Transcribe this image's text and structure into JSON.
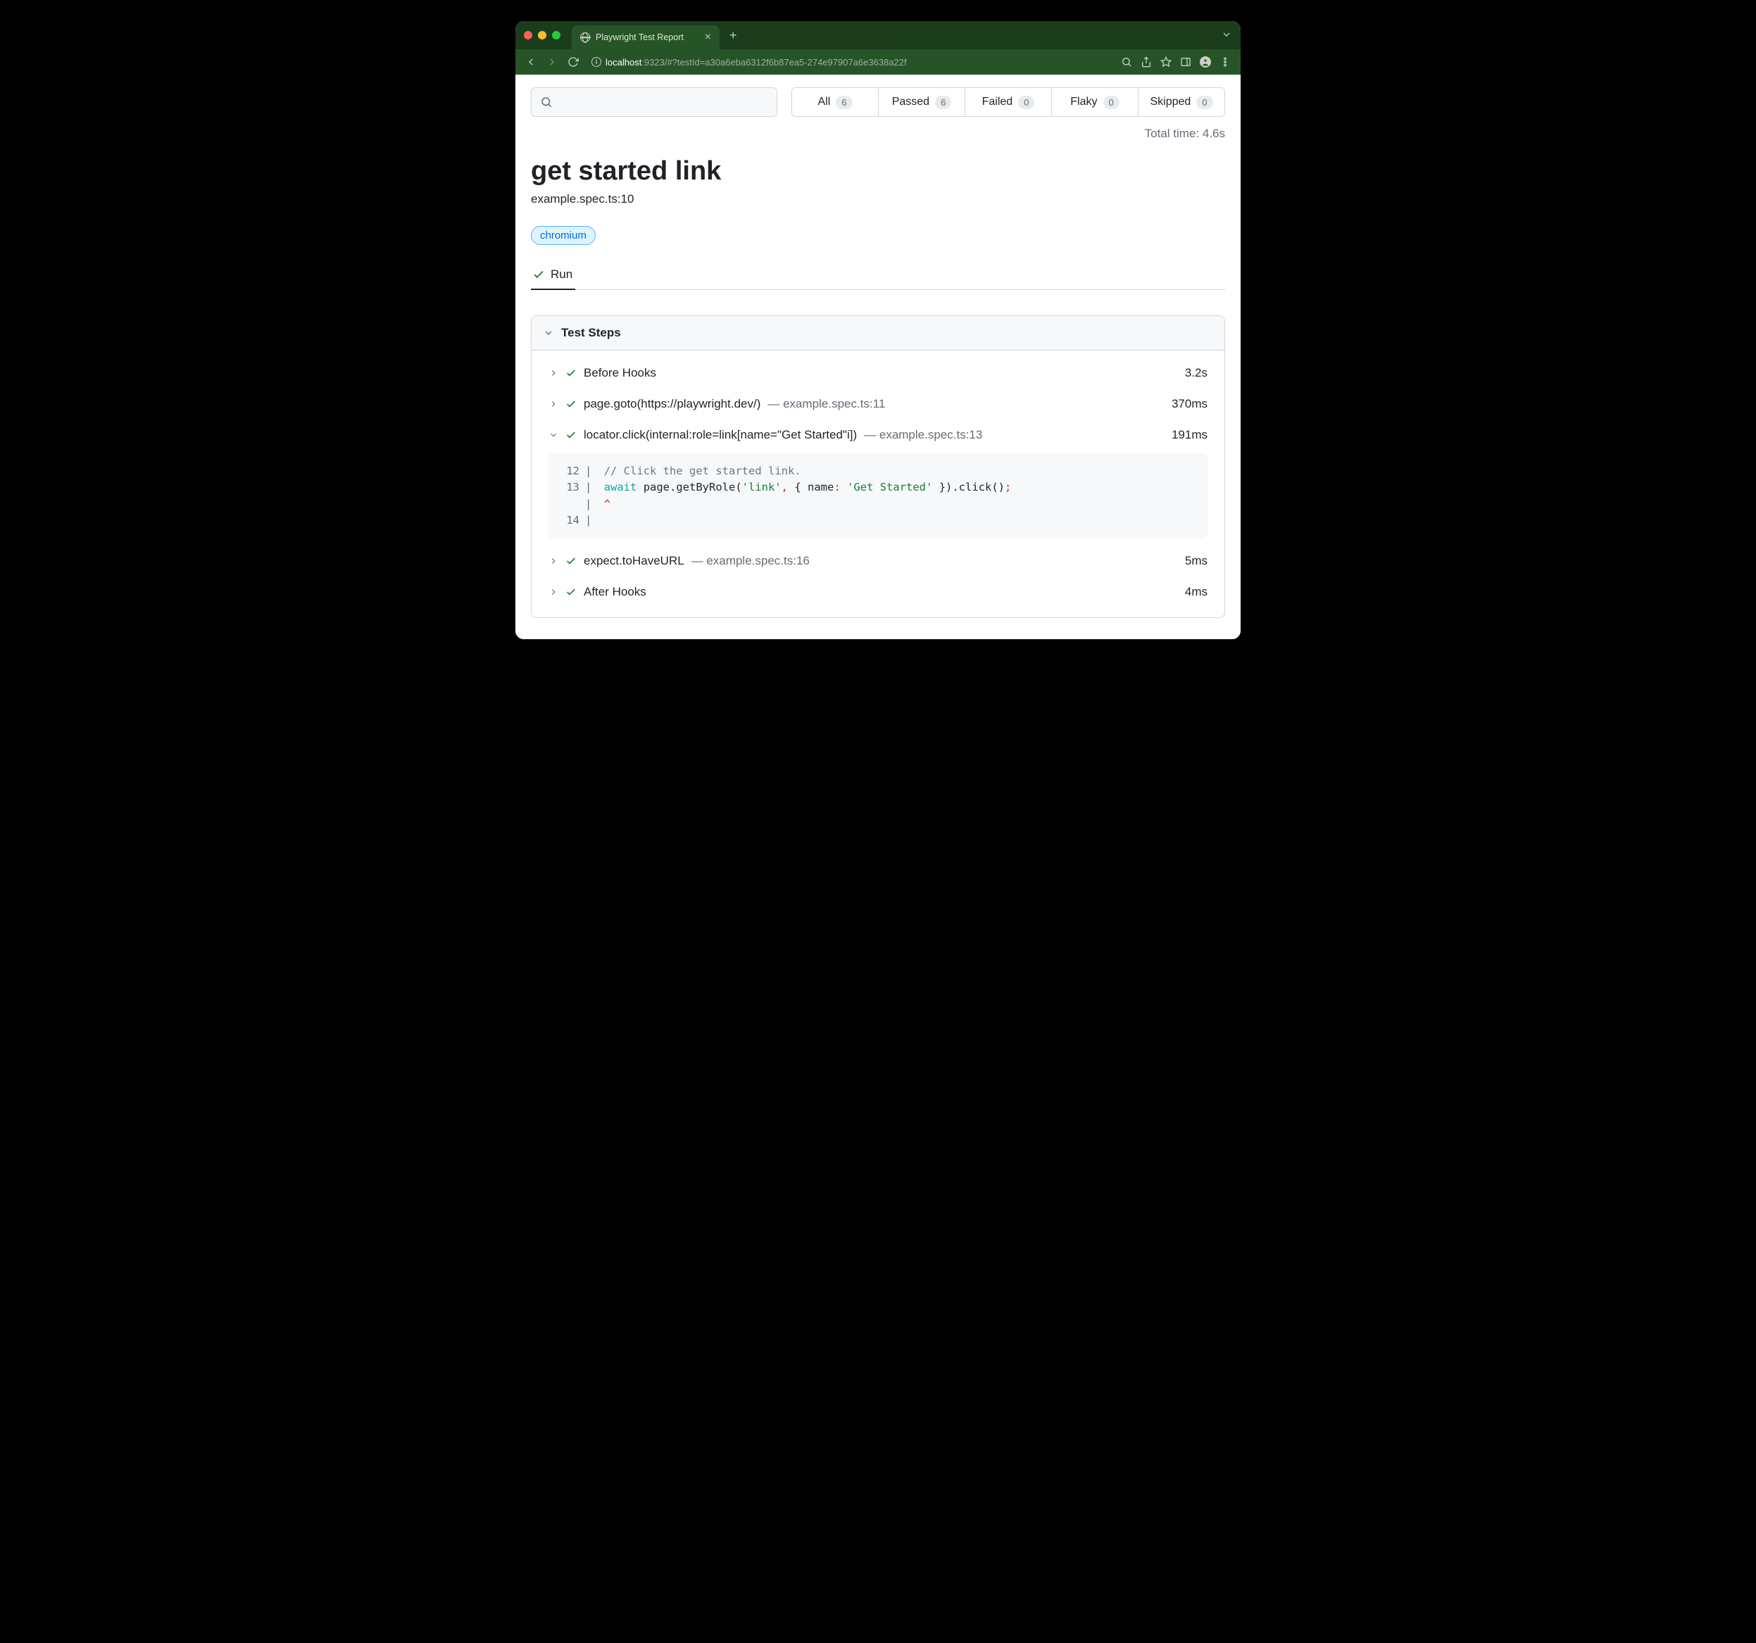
{
  "browser": {
    "tab_title": "Playwright Test Report",
    "url_host": "localhost",
    "url_rest": ":9323/#?testId=a30a6eba6312f6b87ea5-274e97907a6e3638a22f"
  },
  "filters": {
    "all": {
      "label": "All",
      "count": "6"
    },
    "passed": {
      "label": "Passed",
      "count": "6"
    },
    "failed": {
      "label": "Failed",
      "count": "0"
    },
    "flaky": {
      "label": "Flaky",
      "count": "0"
    },
    "skipped": {
      "label": "Skipped",
      "count": "0"
    }
  },
  "total_time": "Total time: 4.6s",
  "test": {
    "title": "get started link",
    "location": "example.spec.ts:10",
    "browser_chip": "chromium"
  },
  "run_tab": "Run",
  "steps_header": "Test Steps",
  "steps": [
    {
      "chev": "right",
      "name": "Before Hooks",
      "src": "",
      "dur": "3.2s"
    },
    {
      "chev": "right",
      "name": "page.goto(https://playwright.dev/)",
      "src": "— example.spec.ts:11",
      "dur": "370ms"
    },
    {
      "chev": "down",
      "name": "locator.click(internal:role=link[name=\"Get Started\"i])",
      "src": "— example.spec.ts:13",
      "dur": "191ms"
    },
    {
      "chev": "right",
      "name": "expect.toHaveURL",
      "src": "— example.spec.ts:16",
      "dur": "5ms"
    },
    {
      "chev": "right",
      "name": "After Hooks",
      "src": "",
      "dur": "4ms"
    }
  ],
  "code": {
    "l12_num": "12",
    "l12_comment": "// Click the get started link.",
    "l13_num": "13",
    "l13_kw": "await",
    "l13_mid1": " page.getByRole(",
    "l13_str1": "'link'",
    "l13_mid2": " { name",
    "l13_colon": ":",
    "l13_str2": "'Get Started'",
    "l13_mid3": " }).click()",
    "l13_semi": ";",
    "l14_num": "14",
    "caret": "^"
  }
}
